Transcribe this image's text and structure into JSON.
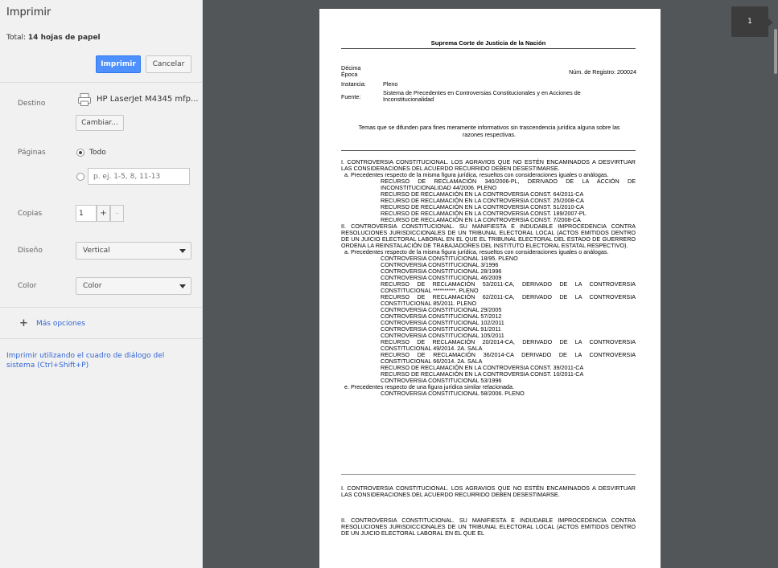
{
  "sidebar": {
    "title": "Imprimir",
    "total_label": "Total: ",
    "total_value": "14 hojas de papel",
    "print_button": "Imprimir",
    "cancel_button": "Cancelar",
    "destination": {
      "label": "Destino",
      "printer": "HP LaserJet M4345 mfp...",
      "change_button": "Cambiar..."
    },
    "pages": {
      "label": "Páginas",
      "all_option": "Todo",
      "range_placeholder": "p. ej. 1-5, 8, 11-13"
    },
    "copies": {
      "label": "Copias",
      "value": "1",
      "plus": "+",
      "minus": "–"
    },
    "layout": {
      "label": "Diseño",
      "value": "Vertical"
    },
    "color": {
      "label": "Color",
      "value": "Color"
    },
    "more_options": "Más opciones",
    "system_dialog": "Imprimir utilizando el cuadro de diálogo del sistema (Ctrl+Shift+P)"
  },
  "preview": {
    "page_number": "1",
    "document": {
      "title": "Suprema Corte de Justicia de la Nación",
      "epoch_label": "Décima\nÉpoca",
      "registry": "Núm. de Registro: 200024",
      "instance_label": "Instancia:",
      "instance_value": "Pleno",
      "source_label": "Fuente:",
      "source_value": "Sistema de Precedentes en Controversias Constitucionales y en Acciones de Inconstitucionalidad",
      "note": "Temas que se difunden para fines meramente informativos sin trascendencia jurídica alguna sobre las razones respectivas.",
      "lines": [
        {
          "cls": "just",
          "text": "I. CONTROVERSIA CONSTITUCIONAL. LOS AGRAVIOS QUE NO ESTÉN ENCAMINADOS A DESVIRTUAR LAS CONSIDERACIONES DEL ACUERDO RECURRIDO DEBEN DESESTIMARSE."
        },
        {
          "cls": "i1 just",
          "text": "a. Precedentes respecto de la misma figura jurídica, resueltos con consideraciones iguales o análogas."
        },
        {
          "cls": "i2 just",
          "text": "RECURSO DE RECLAMACIÓN 340/2006-PL, DERIVADO DE LA ACCIÓN DE INCONSTITUCIONALIDAD 44/2006. PLENO"
        },
        {
          "cls": "i2",
          "text": "RECURSO DE RECLAMACIÓN EN LA CONTROVERSIA CONST. 64/2011-CA"
        },
        {
          "cls": "i2",
          "text": "RECURSO DE RECLAMACIÓN EN LA CONTROVERSIA CONST. 25/2008-CA"
        },
        {
          "cls": "i2",
          "text": "RECURSO DE RECLAMACIÓN EN LA CONTROVERSIA CONST. 51/2010-CA"
        },
        {
          "cls": "i2",
          "text": "RECURSO DE RECLAMACIÓN EN LA CONTROVERSIA CONST. 189/2007-PL"
        },
        {
          "cls": "i2",
          "text": "RECURSO DE RECLAMACIÓN EN LA CONTROVERSIA CONST. 7/2008-CA"
        },
        {
          "cls": "just",
          "text": "II. CONTROVERSIA CONSTITUCIONAL. SU MANIFIESTA E INDUDABLE IMPROCEDENCIA CONTRA RESOLUCIONES JURISDICCIONALES DE UN TRIBUNAL ELECTORAL LOCAL (ACTOS EMITIDOS DENTRO DE UN JUICIO ELECTORAL LABORAL EN EL QUE EL TRIBUNAL ELECTORAL DEL ESTADO DE GUERRERO ORDENA LA REINSTALACIÓN DE TRABAJADORES DEL INSTITUTO ELECTORAL ESTATAL RESPECTIVO)."
        },
        {
          "cls": "i1 just",
          "text": "a. Precedentes respecto de la misma figura jurídica, resueltos con consideraciones iguales o análogas."
        },
        {
          "cls": "i2",
          "text": "CONTROVERSIA CONSTITUCIONAL 18/95. PLENO"
        },
        {
          "cls": "i2",
          "text": "CONTROVERSIA CONSTITUCIONAL 3/1996"
        },
        {
          "cls": "i2",
          "text": "CONTROVERSIA CONSTITUCIONAL 28/1996"
        },
        {
          "cls": "i2",
          "text": "CONTROVERSIA CONSTITUCIONAL 46/2009"
        },
        {
          "cls": "i2 just",
          "text": "RECURSO DE RECLAMACIÓN 53/2011-CA, DERIVADO DE LA CONTROVERSIA CONSTITUCIONAL **********. PLENO"
        },
        {
          "cls": "i2 just",
          "text": "RECURSO DE RECLAMACIÓN 62/2011-CA, DERIVADO DE LA CONTROVERSIA CONSTITUCIONAL 85/2011. PLENO"
        },
        {
          "cls": "i2",
          "text": "CONTROVERSIA CONSTITUCIONAL 29/2005"
        },
        {
          "cls": "i2",
          "text": "CONTROVERSIA CONSTITUCIONAL 57/2012"
        },
        {
          "cls": "i2",
          "text": "CONTROVERSIA CONSTITUCIONAL 102/2011"
        },
        {
          "cls": "i2",
          "text": "CONTROVERSIA CONSTITUCIONAL 91/2011"
        },
        {
          "cls": "i2",
          "text": "CONTROVERSIA CONSTITUCIONAL 105/2011"
        },
        {
          "cls": "i2 just",
          "text": "RECURSO DE RECLAMACIÓN 20/2014-CA, DERIVADO DE LA CONTROVERSIA CONSTITUCIONAL 49/2014. 2A. SALA"
        },
        {
          "cls": "i2 just",
          "text": "RECURSO DE RECLAMACIÓN 36/2014-CA DERIVADO DE LA CONTROVERSIA CONSTITUCIONAL 66/2014. 2A. SALA"
        },
        {
          "cls": "i2",
          "text": "RECURSO DE RECLAMACIÓN EN LA CONTROVERSIA CONST. 39/2011-CA"
        },
        {
          "cls": "i2",
          "text": "RECURSO DE RECLAMACIÓN EN LA CONTROVERSIA CONST. 10/2011-CA"
        },
        {
          "cls": "i2",
          "text": "CONTROVERSIA CONSTITUCIONAL 53/1996"
        },
        {
          "cls": "i1",
          "text": "e. Precedentes respecto de una figura jurídica similar relacionada."
        },
        {
          "cls": "i2",
          "text": "CONTROVERSIA CONSTITUCIONAL 58/2006. PLENO"
        }
      ],
      "summary_1": "I. CONTROVERSIA CONSTITUCIONAL. LOS AGRAVIOS QUE NO ESTÉN ENCAMINADOS A DESVIRTUAR LAS CONSIDERACIONES DEL ACUERDO RECURRIDO DEBEN DESESTIMARSE.",
      "summary_2": "II. CONTROVERSIA CONSTITUCIONAL. SU MANIFIESTA E INDUDABLE IMPROCEDENCIA CONTRA RESOLUCIONES JURISDICCIONALES DE UN TRIBUNAL ELECTORAL LOCAL (ACTOS EMITIDOS DENTRO DE UN JUICIO ELECTORAL LABORAL EN EL QUE EL"
    }
  },
  "colors": {
    "accent": "#4d90fe",
    "link": "#3367d6",
    "preview_bg": "#525659",
    "sidebar_bg": "#f1f1f1"
  },
  "icons": [
    "printer-icon",
    "plus-icon",
    "chevron-down-icon"
  ]
}
